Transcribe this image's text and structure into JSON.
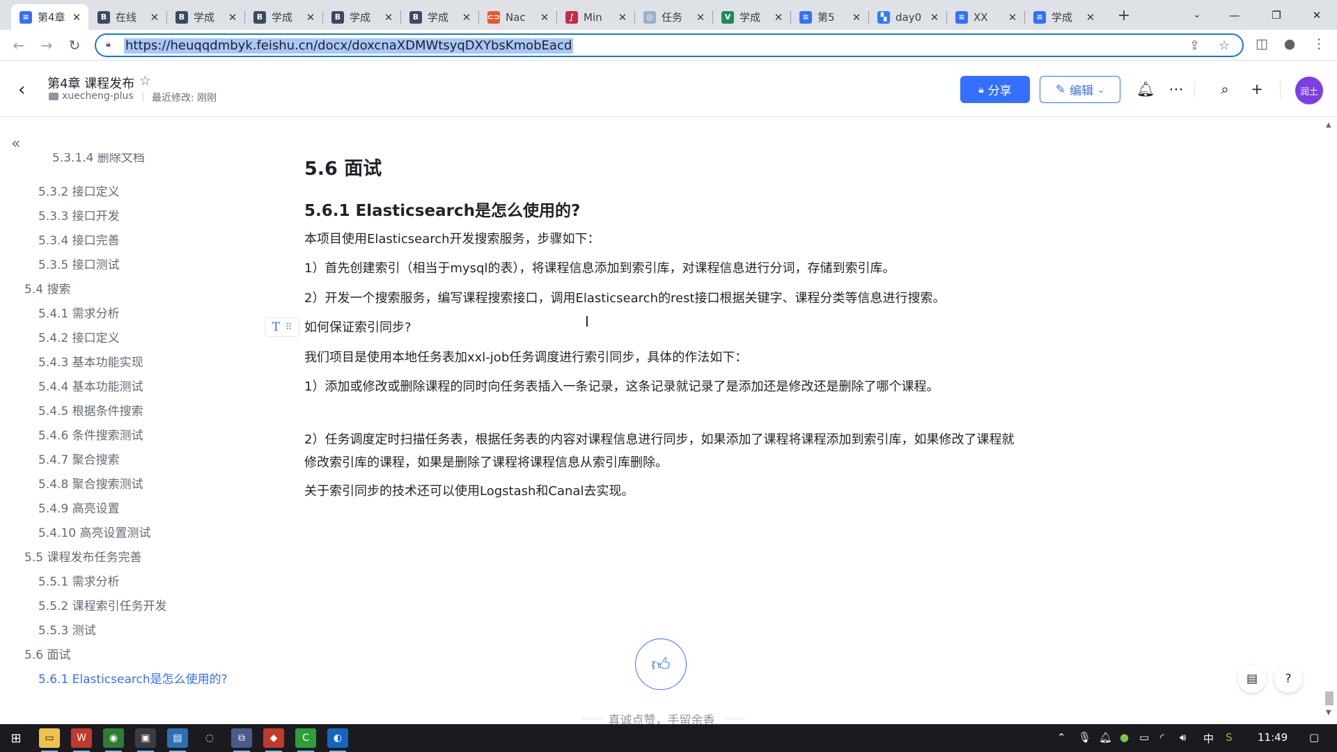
{
  "browser": {
    "tabs": [
      {
        "label": "第4章",
        "icon": "feishu-doc-icon",
        "active": true,
        "color": "#3370ff",
        "glyph": "≡"
      },
      {
        "label": "在线",
        "icon": "b-doc-icon",
        "color": "#3a4a63",
        "glyph": "B"
      },
      {
        "label": "学成",
        "icon": "b-doc-icon",
        "color": "#3a4a63",
        "glyph": "B"
      },
      {
        "label": "学成",
        "icon": "b-doc-icon",
        "color": "#3a4a63",
        "glyph": "B"
      },
      {
        "label": "学成",
        "icon": "b-doc-icon",
        "color": "#3a4a63",
        "glyph": "B"
      },
      {
        "label": "学成",
        "icon": "b-doc-icon",
        "color": "#3a4a63",
        "glyph": "B"
      },
      {
        "label": "Nac",
        "icon": "nacos-icon",
        "color": "#e8572b",
        "glyph": "⊂⊃"
      },
      {
        "label": "Min",
        "icon": "minio-icon",
        "color": "#c72c48",
        "glyph": "∫"
      },
      {
        "label": "任务",
        "icon": "xxljob-icon",
        "color": "#9ab0c9",
        "glyph": "◎"
      },
      {
        "label": "学成",
        "icon": "vue-icon",
        "color": "#1f8a5c",
        "glyph": "V"
      },
      {
        "label": "第5",
        "icon": "feishu-doc-icon",
        "color": "#3370ff",
        "glyph": "≡"
      },
      {
        "label": "day0",
        "icon": "feishu-doc-icon",
        "color": "#2f7df6",
        "glyph": "▚"
      },
      {
        "label": "XX",
        "icon": "feishu-doc-icon",
        "color": "#3370ff",
        "glyph": "≡"
      },
      {
        "label": "学成",
        "icon": "feishu-doc-icon",
        "color": "#3370ff",
        "glyph": "≡"
      }
    ],
    "url": "https://heuqqdmbyk.feishu.cn/docx/doxcnaXDMWtsyqDXYbsKmobEacd"
  },
  "doc": {
    "title": "第4章 课程发布",
    "space": "xuecheng-plus",
    "last_modified": "最近修改: 刚刚",
    "share_label": "分享",
    "edit_label": "编辑",
    "avatar_text": "润土"
  },
  "outline": [
    {
      "label": "5.3.1.4 删除文档",
      "level": 3
    },
    {
      "label": "5.3.2 接口定义",
      "level": 2
    },
    {
      "label": "5.3.3 接口开发",
      "level": 2
    },
    {
      "label": "5.3.4 接口完善",
      "level": 2
    },
    {
      "label": "5.3.5 接口测试",
      "level": 2
    },
    {
      "label": "5.4 搜索",
      "level": 1
    },
    {
      "label": "5.4.1 需求分析",
      "level": 2
    },
    {
      "label": "5.4.2 接口定义",
      "level": 2
    },
    {
      "label": "5.4.3 基本功能实现",
      "level": 2
    },
    {
      "label": "5.4.4 基本功能测试",
      "level": 2
    },
    {
      "label": "5.4.5 根据条件搜索",
      "level": 2
    },
    {
      "label": "5.4.6 条件搜索测试",
      "level": 2
    },
    {
      "label": "5.4.7 聚合搜索",
      "level": 2
    },
    {
      "label": "5.4.8 聚合搜索测试",
      "level": 2
    },
    {
      "label": "5.4.9 高亮设置",
      "level": 2
    },
    {
      "label": "5.4.10 高亮设置测试",
      "level": 2
    },
    {
      "label": "5.5 课程发布任务完善",
      "level": 1
    },
    {
      "label": "5.5.1 需求分析",
      "level": 2
    },
    {
      "label": "5.5.2 课程索引任务开发",
      "level": 2
    },
    {
      "label": "5.5.3 测试",
      "level": 2
    },
    {
      "label": "5.6 面试",
      "level": 1
    },
    {
      "label": "5.6.1 Elasticsearch是怎么使用的?",
      "level": 2,
      "active": true
    }
  ],
  "content": {
    "h2": "5.6 面试",
    "h3": "5.6.1 Elasticsearch是怎么使用的?",
    "p1": "本项目使用Elasticsearch开发搜索服务，步骤如下：",
    "p2": "1）首先创建索引（相当于mysql的表），将课程信息添加到索引库，对课程信息进行分词，存储到索引库。",
    "p3": "2）开发一个搜索服务，编写课程搜索接口，调用Elasticsearch的rest接口根据关键字、课程分类等信息进行搜索。",
    "p4": "如何保证索引同步?",
    "p5": "我们项目是使用本地任务表加xxl-job任务调度进行索引同步，具体的作法如下：",
    "p6": "1）添加或修改或删除课程的同时向任务表插入一条记录，这条记录就记录了是添加还是修改还是删除了哪个课程。",
    "p7": "2）任务调度定时扫描任务表，根据任务表的内容对课程信息进行同步，如果添加了课程将课程添加到索引库，如果修改了课程就修改索引库的课程，如果是删除了课程将课程信息从索引库删除。",
    "p8": "关于索引同步的技术还可以使用Logstash和Canal去实现。",
    "like_caption": "真诚点赞，手留余香"
  },
  "taskbar": {
    "clock": "11:49",
    "ime": "中"
  },
  "colors": {
    "accent": "#3370ff",
    "text": "#1f2329",
    "muted": "#646a73"
  }
}
